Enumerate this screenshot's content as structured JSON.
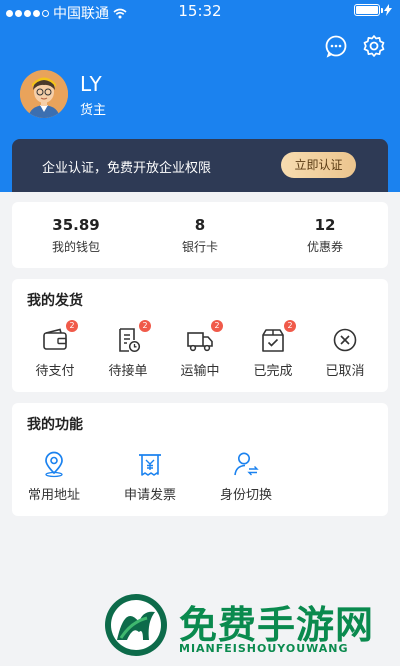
{
  "status_bar": {
    "carrier": "中国联通",
    "time": "15:32"
  },
  "profile": {
    "name": "LY",
    "role": "货主"
  },
  "banner": {
    "text": "企业认证，免费开放企业权限",
    "button_label": "立即认证"
  },
  "stats": [
    {
      "value": "35.89",
      "label": "我的钱包"
    },
    {
      "value": "8",
      "label": "银行卡"
    },
    {
      "value": "12",
      "label": "优惠券"
    }
  ],
  "orders": {
    "title": "我的发货",
    "items": [
      {
        "label": "待支付",
        "badge": "2",
        "icon": "wallet-icon"
      },
      {
        "label": "待接单",
        "badge": "2",
        "icon": "document-clock-icon"
      },
      {
        "label": "运输中",
        "badge": "2",
        "icon": "truck-icon"
      },
      {
        "label": "已完成",
        "badge": "2",
        "icon": "box-check-icon"
      },
      {
        "label": "已取消",
        "icon": "circle-x-icon"
      }
    ]
  },
  "functions": {
    "title": "我的功能",
    "items": [
      {
        "label": "常用地址",
        "icon": "location-pin-icon"
      },
      {
        "label": "申请发票",
        "icon": "invoice-icon"
      },
      {
        "label": "身份切换",
        "icon": "user-switch-icon"
      }
    ]
  },
  "watermark": {
    "title": "免费手游网",
    "subtitle": "MIANFEISHOUYOUWANG"
  },
  "colors": {
    "header_blue": "#1b82ef",
    "banner_dark": "#2e3a55",
    "accent_gold": "#ecc58e",
    "badge_red": "#f05a4a",
    "watermark_green": "#0a8a4e"
  }
}
